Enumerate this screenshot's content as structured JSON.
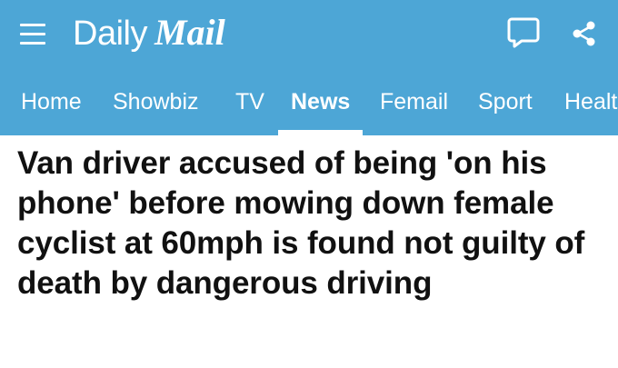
{
  "header": {
    "brand_daily": "Daily",
    "brand_mail": "Mail",
    "background_color": "#4da6d6",
    "menu_icon": "hamburger-menu-icon",
    "comment_icon": "comment-icon",
    "share_icon": "share-icon"
  },
  "nav": {
    "items": [
      {
        "label": "Home"
      },
      {
        "label": "Showbiz"
      },
      {
        "label": "TV"
      },
      {
        "label": "News",
        "active": true
      },
      {
        "label": "Femail"
      },
      {
        "label": "Sport"
      },
      {
        "label": "Healt"
      }
    ]
  },
  "article": {
    "headline": "Van driver accused of being 'on his phone' before mowing down female cyclist at 60mph is found not guilty of death by dangerous driving"
  }
}
